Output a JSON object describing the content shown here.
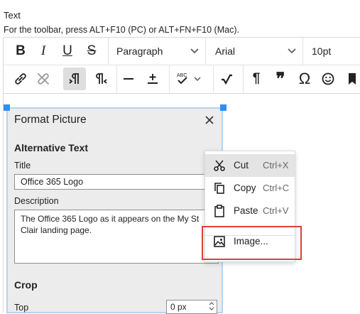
{
  "header": {
    "label": "Text",
    "hint": "For the toolbar, press ALT+F10 (PC) or ALT+FN+F10 (Mac)."
  },
  "toolbar": {
    "row1": {
      "bold": "B",
      "italic": "I",
      "underline": "U",
      "strikethrough": "S",
      "block_format": "Paragraph",
      "font_family": "Arial",
      "font_size": "10pt"
    },
    "row2": {
      "paragraph_mark": "¶",
      "blockquote": "❞",
      "omega": "Ω"
    },
    "icons": [
      "link-icon",
      "unlink-icon",
      "ltr-icon",
      "rtl-icon",
      "horizontal-line-icon",
      "plus-minus-icon",
      "spellcheck-icon",
      "math-icon",
      "paragraph-icon",
      "blockquote-icon",
      "omega-icon",
      "emoji-icon",
      "bookmark-icon"
    ]
  },
  "dialog": {
    "title": "Format Picture",
    "alt_section": "Alternative Text",
    "title_label": "Title",
    "title_value": "Office 365 Logo",
    "description_label": "Description",
    "description_value": "The Office 365 Logo as it appears on the My St Clair landing page.",
    "crop_section": "Crop",
    "top_label": "Top",
    "top_value": "0 px"
  },
  "context_menu": {
    "items": [
      {
        "label": "Cut",
        "shortcut": "Ctrl+X",
        "icon": "scissors-icon"
      },
      {
        "label": "Copy",
        "shortcut": "Ctrl+C",
        "icon": "copy-icon"
      },
      {
        "label": "Paste",
        "shortcut": "Ctrl+V",
        "icon": "clipboard-icon"
      },
      {
        "label": "Image...",
        "shortcut": "",
        "icon": "image-icon"
      }
    ]
  },
  "colors": {
    "selection_handle": "#2f8ff0",
    "dialog_border": "#b5d3f0",
    "highlight_box": "#d9433c",
    "active_button": "#dedede"
  }
}
